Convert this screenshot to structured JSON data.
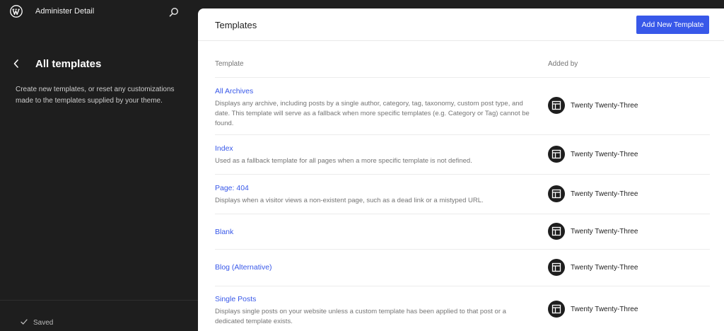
{
  "header": {
    "site_title": "Administer Detail"
  },
  "sidebar": {
    "heading": "All templates",
    "description": "Create new templates, or reset any customizations made to the templates supplied by your theme.",
    "footer_status": "Saved"
  },
  "main": {
    "title": "Templates",
    "add_button_label": "Add New Template",
    "columns": [
      "Template",
      "Added by"
    ],
    "rows": [
      {
        "title": "All Archives",
        "description": "Displays any archive, including posts by a single author, category, tag, taxonomy, custom post type, and date. This template will serve as a fallback when more specific templates (e.g. Category or Tag) cannot be found.",
        "added_by": "Twenty Twenty-Three"
      },
      {
        "title": "Index",
        "description": "Used as a fallback template for all pages when a more specific template is not defined.",
        "added_by": "Twenty Twenty-Three"
      },
      {
        "title": "Page: 404",
        "description": "Displays when a visitor views a non-existent page, such as a dead link or a mistyped URL.",
        "added_by": "Twenty Twenty-Three"
      },
      {
        "title": "Blank",
        "description": "",
        "added_by": "Twenty Twenty-Three"
      },
      {
        "title": "Blog (Alternative)",
        "description": "",
        "added_by": "Twenty Twenty-Three"
      },
      {
        "title": "Single Posts",
        "description": "Displays single posts on your website unless a custom template has been applied to that post or a dedicated template exists.",
        "added_by": "Twenty Twenty-Three"
      }
    ]
  },
  "icons": {
    "logo": "wordpress-logo-icon",
    "search": "search-icon",
    "back": "chevron-left-icon",
    "saved": "check-icon",
    "author": "layout-icon"
  },
  "colors": {
    "sidebar_bg": "#1e1e1e",
    "accent": "#3858e9",
    "text_muted": "#757575"
  }
}
